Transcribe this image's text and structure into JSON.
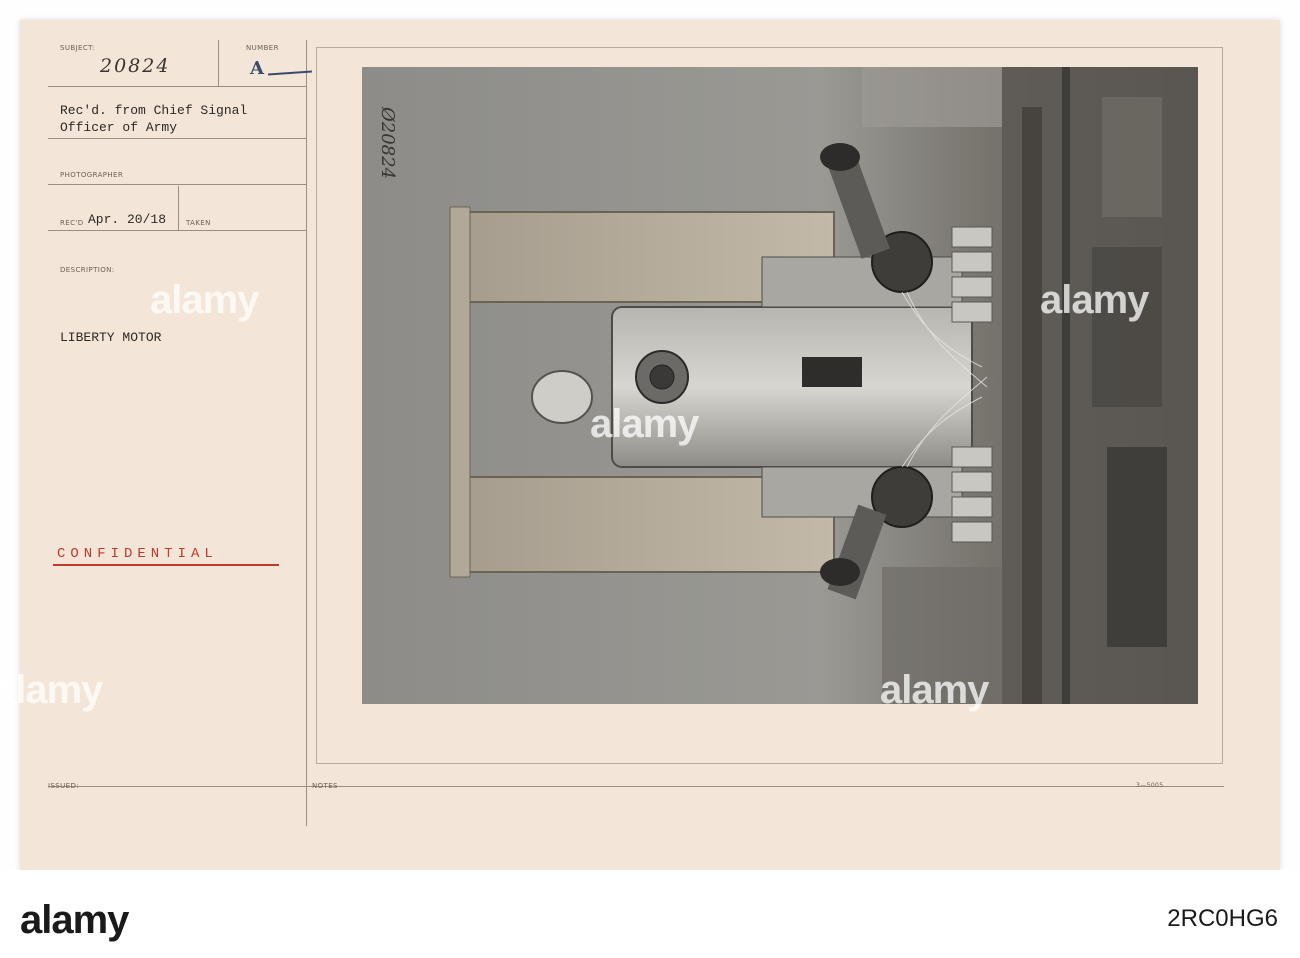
{
  "card": {
    "subject_label": "SUBJECT:",
    "subject_value": "20824",
    "number_label": "NUMBER",
    "number_value": "A",
    "received_from": "Rec'd. from Chief Signal\nOfficer of Army",
    "photographer_label": "PHOTOGRAPHER",
    "recd_label": "REC'D",
    "recd_value": "Apr. 20/18",
    "taken_label": "TAKEN",
    "description_label": "DESCRIPTION:",
    "description_value": "LIBERTY MOTOR",
    "confidential": "CONFIDENTIAL",
    "issued_label": "ISSUED:",
    "notes_label": "NOTES",
    "form_code": "3—5005",
    "photo_inscription": "Ø20824"
  },
  "watermark": {
    "text": "alamy"
  },
  "footer": {
    "logo": "alamy",
    "image_code": "2RC0HG6"
  },
  "colors": {
    "card_bg": "#f3e6d8",
    "confidential": "#c0392b",
    "photo_gray": "#8a8a87"
  }
}
